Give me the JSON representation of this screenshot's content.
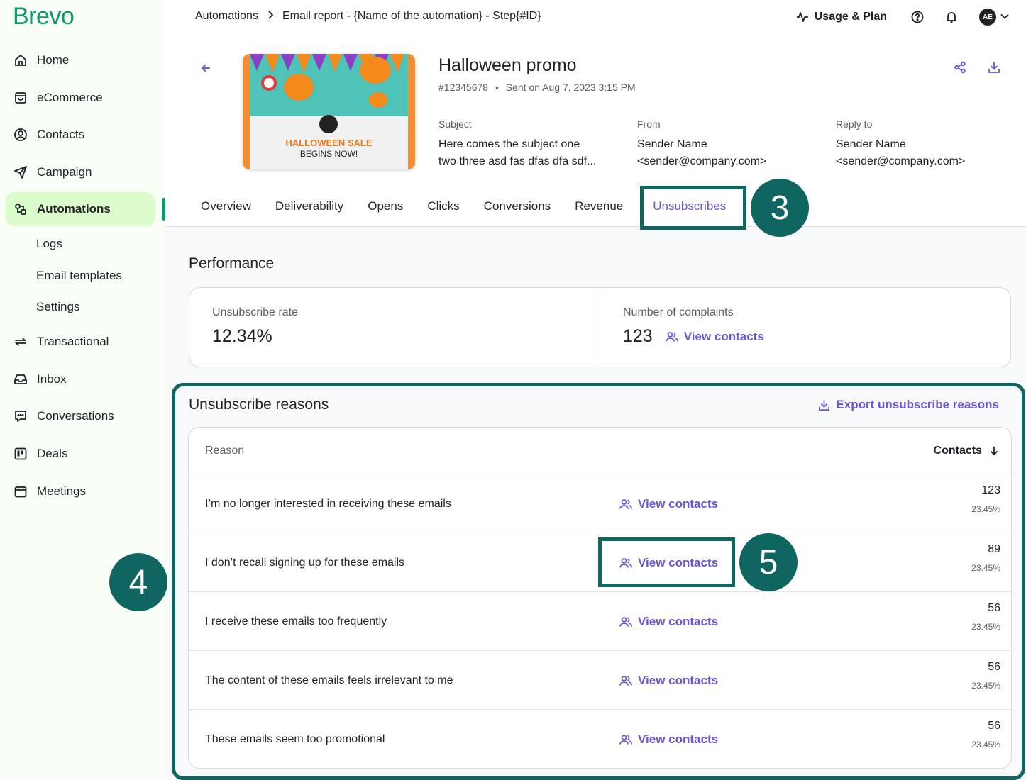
{
  "brand": {
    "name": "Brevo",
    "color": "#0b996e"
  },
  "sidebar": {
    "items": [
      {
        "label": "Home",
        "icon": "home-icon"
      },
      {
        "label": "eCommerce",
        "icon": "shopping-bag-icon"
      },
      {
        "label": "Contacts",
        "icon": "contacts-icon"
      },
      {
        "label": "Campaign",
        "icon": "send-icon"
      },
      {
        "label": "Automations",
        "icon": "automation-icon",
        "active": true
      },
      {
        "label": "Transactional",
        "icon": "transactional-icon"
      },
      {
        "label": "Inbox",
        "icon": "inbox-icon"
      },
      {
        "label": "Conversations",
        "icon": "chat-icon"
      },
      {
        "label": "Deals",
        "icon": "deals-icon"
      },
      {
        "label": "Meetings",
        "icon": "calendar-icon"
      }
    ],
    "subitems": [
      "Logs",
      "Email templates",
      "Settings"
    ]
  },
  "breadcrumb": {
    "root": "Automations",
    "current": "Email report - {Name of the automation} - Step{#ID}"
  },
  "topbar": {
    "usage_label": "Usage & Plan",
    "avatar_initials": "AE"
  },
  "email": {
    "title": "Halloween promo",
    "id": "#12345678",
    "sent": "Sent on Aug 7, 2023 3:15 PM",
    "thumbnail": {
      "line1": "HALLOWEEN SALE",
      "line2": "BEGINS NOW!"
    },
    "subject_label": "Subject",
    "subject_line1": "Here comes the subject one",
    "subject_line2": "two three asd fas dfas dfa sdf...",
    "from_label": "From",
    "from_name": "Sender Name",
    "from_email": "<sender@company.com>",
    "reply_label": "Reply to",
    "reply_name": "Sender Name",
    "reply_email": "<sender@company.com>"
  },
  "tabs": [
    "Overview",
    "Deliverability",
    "Opens",
    "Clicks",
    "Conversions",
    "Revenue",
    "Unsubscribes"
  ],
  "active_tab": "Unsubscribes",
  "callouts": {
    "tab": "3",
    "section": "4",
    "link": "5"
  },
  "performance": {
    "title": "Performance",
    "unsub_rate_label": "Unsubscribe rate",
    "unsub_rate_value": "12.34%",
    "complaints_label": "Number of complaints",
    "complaints_value": "123",
    "view_contacts": "View contacts"
  },
  "reasons": {
    "title": "Unsubscribe reasons",
    "export_label": "Export unsubscribe reasons",
    "col_reason": "Reason",
    "col_contacts": "Contacts",
    "view_contacts": "View contacts",
    "rows": [
      {
        "reason": "I’m no longer interested in receiving these emails",
        "count": "123",
        "pct": "23.45%"
      },
      {
        "reason": "I don’t recall signing up for these emails",
        "count": "89",
        "pct": "23.45%"
      },
      {
        "reason": "I receive these emails too frequently",
        "count": "56",
        "pct": "23.45%"
      },
      {
        "reason": "The content of these emails feels irrelevant to me",
        "count": "56",
        "pct": "23.45%"
      },
      {
        "reason": "These emails seem too promotional",
        "count": "56",
        "pct": "23.45%"
      }
    ]
  },
  "colors": {
    "accent": "#6b55d6",
    "highlight": "#0f6660",
    "active_nav_bg": "#dcfccc"
  }
}
